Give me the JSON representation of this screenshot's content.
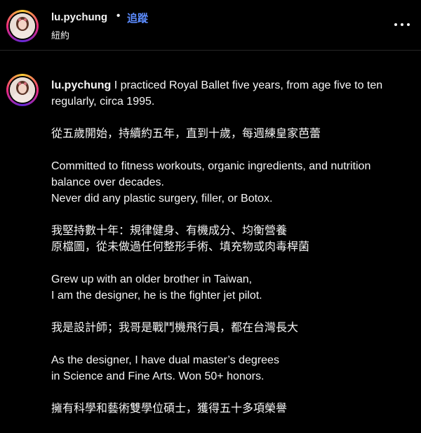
{
  "header": {
    "username": "lu.pychung",
    "separator": "•",
    "follow_label": "追蹤",
    "location": "紐約",
    "more_icon": "more-horizontal-icon"
  },
  "post": {
    "username": "lu.pychung",
    "caption_lead": "I practiced Royal Ballet five years, from age five to ten regularly, circa 1995.",
    "paragraphs": [
      [
        "從五歲開始，持續約五年，直到十歲，每週練皇家芭蕾"
      ],
      [
        "Committed to fitness workouts, organic ingredients, and nutrition balance over decades.",
        "Never did any plastic surgery, filler, or Botox."
      ],
      [
        "我堅持數十年：規律健身、有機成分、均衡營養",
        "原檔圖，從未做過任何整形手術、填充物或肉毒桿菌"
      ],
      [
        "Grew up with an older brother in Taiwan,",
        "I am the designer, he is the fighter jet pilot."
      ],
      [
        "我是設計師；我哥是戰鬥機飛行員，都在台灣長大"
      ],
      [
        "As the designer, I have dual master’s degrees",
        "in Science and Fine Arts. Won 50+ honors."
      ],
      [
        "擁有科學和藝術雙學位碩士，獲得五十多項榮譽"
      ]
    ]
  },
  "colors": {
    "background": "#000000",
    "text": "#f5f5f5",
    "link": "#5c8cff",
    "divider": "#262626"
  }
}
